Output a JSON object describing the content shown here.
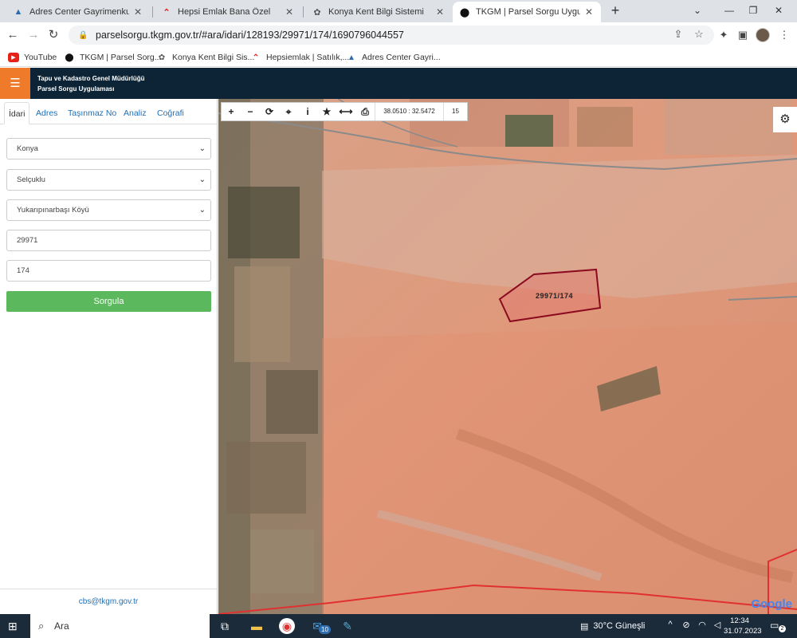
{
  "browser": {
    "tabs": [
      {
        "title": "Adres Center Gayrimenkul ve Yat",
        "icon": "adres-center-icon",
        "active": false
      },
      {
        "title": "Hepsi Emlak Bana Özel",
        "icon": "hepsiemlak-icon",
        "active": false
      },
      {
        "title": "Konya Kent Bilgi Sistemi",
        "icon": "konya-icon",
        "active": false
      },
      {
        "title": "TKGM | Parsel Sorgu Uygulaması",
        "icon": "map-pin-icon",
        "active": true
      }
    ],
    "url": "parselsorgu.tkgm.gov.tr/#ara/idari/128193/29971/174/1690796044557",
    "bookmarks": [
      {
        "label": "YouTube",
        "icon": "youtube-icon"
      },
      {
        "label": "TKGM | Parsel Sorg...",
        "icon": "map-pin-icon"
      },
      {
        "label": "Konya Kent Bilgi Sis...",
        "icon": "konya-icon"
      },
      {
        "label": "Hepsiemlak | Satılık,...",
        "icon": "hepsiemlak-icon"
      },
      {
        "label": "Adres Center Gayri...",
        "icon": "adres-center-icon"
      }
    ]
  },
  "app": {
    "title_line1": "Tapu ve Kadastro Genel Müdürlüğü",
    "title_line2": "Parsel Sorgu Uygulaması",
    "brand_color": "#0c2436",
    "accent_color": "#ef7b2a"
  },
  "sidebar": {
    "tabs": [
      {
        "label": "İdari",
        "active": true
      },
      {
        "label": "Adres",
        "active": false
      },
      {
        "label": "Taşınmaz No",
        "active": false
      },
      {
        "label": "Analiz",
        "active": false
      },
      {
        "label": "Coğrafi",
        "active": false
      }
    ],
    "province": "Konya",
    "district": "Selçuklu",
    "neighborhood": "Yukarıpınarbaşı Köyü",
    "block_no": "29971",
    "parcel_no": "174",
    "submit_label": "Sorgula",
    "submit_color": "#5cb85c",
    "footer_email": "cbs@tkgm.gov.tr"
  },
  "map": {
    "coordinates": "38.0510 : 32.5472",
    "zoom": "15",
    "parcel_label": "29971/174",
    "attribution": "Google",
    "tools": [
      "plus-icon",
      "minus-icon",
      "refresh-icon",
      "crosshair-icon",
      "info-icon",
      "star-icon",
      "measure-icon",
      "print-icon"
    ]
  },
  "taskbar": {
    "search_placeholder": "Ara",
    "mail_badge": "10",
    "weather": "30°C  Güneşli",
    "time": "12:34",
    "date": "31.07.2023",
    "notifications": "2"
  }
}
